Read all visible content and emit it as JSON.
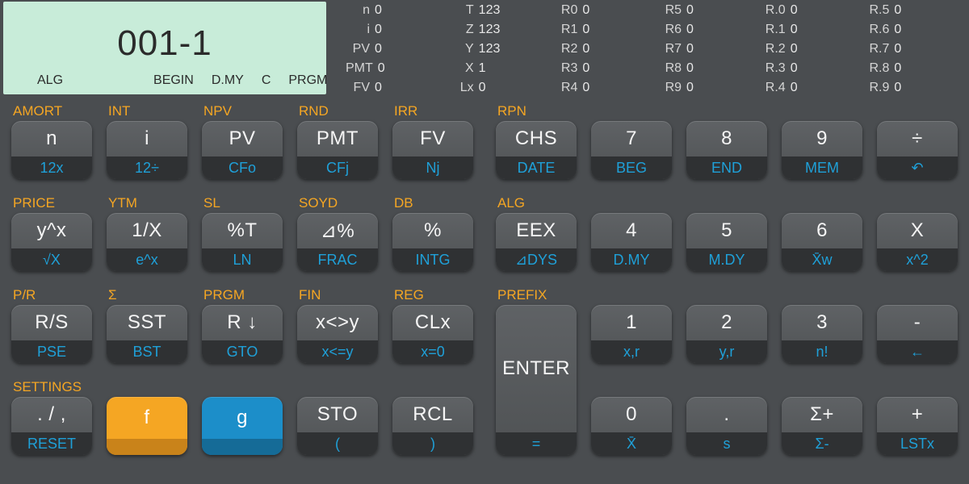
{
  "lcd": {
    "main": "001-1",
    "annunciators": [
      "ALG",
      "BEGIN",
      "D.MY",
      "C",
      "PRGM"
    ]
  },
  "registers": {
    "col1": [
      [
        "n",
        "0"
      ],
      [
        "i",
        "0"
      ],
      [
        "PV",
        "0"
      ],
      [
        "PMT",
        "0"
      ],
      [
        "FV",
        "0"
      ]
    ],
    "col2": [
      [
        "T",
        "123"
      ],
      [
        "Z",
        "123"
      ],
      [
        "Y",
        "123"
      ],
      [
        "X",
        "1"
      ],
      [
        "Lx",
        "0"
      ]
    ],
    "col3": [
      [
        "R0",
        "0"
      ],
      [
        "R1",
        "0"
      ],
      [
        "R2",
        "0"
      ],
      [
        "R3",
        "0"
      ],
      [
        "R4",
        "0"
      ]
    ],
    "col4": [
      [
        "R5",
        "0"
      ],
      [
        "R6",
        "0"
      ],
      [
        "R7",
        "0"
      ],
      [
        "R8",
        "0"
      ],
      [
        "R9",
        "0"
      ]
    ],
    "col5": [
      [
        "R.0",
        "0"
      ],
      [
        "R.1",
        "0"
      ],
      [
        "R.2",
        "0"
      ],
      [
        "R.3",
        "0"
      ],
      [
        "R.4",
        "0"
      ]
    ],
    "col6": [
      [
        "R.5",
        "0"
      ],
      [
        "R.6",
        "0"
      ],
      [
        "R.7",
        "0"
      ],
      [
        "R.8",
        "0"
      ],
      [
        "R.9",
        "0"
      ]
    ]
  },
  "orange_labels": {
    "r1": [
      "AMORT",
      "INT",
      "NPV",
      "RND",
      "IRR",
      "RPN"
    ],
    "r2": [
      "PRICE",
      "YTM",
      "SL",
      "SOYD",
      "DB",
      "ALG"
    ],
    "r3": [
      "P/R",
      "Σ",
      "PRGM",
      "FIN",
      "REG",
      "PREFIX"
    ],
    "r4": [
      "SETTINGS"
    ]
  },
  "keys": {
    "r1": [
      {
        "face": "n",
        "sub": "12x"
      },
      {
        "face": "i",
        "sub": "12÷"
      },
      {
        "face": "PV",
        "sub": "CFo"
      },
      {
        "face": "PMT",
        "sub": "CFj"
      },
      {
        "face": "FV",
        "sub": "Nj"
      },
      {
        "face": "CHS",
        "sub": "DATE"
      },
      {
        "face": "7",
        "sub": "BEG"
      },
      {
        "face": "8",
        "sub": "END"
      },
      {
        "face": "9",
        "sub": "MEM"
      },
      {
        "face": "÷",
        "sub": "↶"
      }
    ],
    "r2": [
      {
        "face": "y^x",
        "sub": "√X"
      },
      {
        "face": "1/X",
        "sub": "e^x"
      },
      {
        "face": "%T",
        "sub": "LN"
      },
      {
        "face": "⊿%",
        "sub": "FRAC"
      },
      {
        "face": "%",
        "sub": "INTG"
      },
      {
        "face": "EEX",
        "sub": "⊿DYS"
      },
      {
        "face": "4",
        "sub": "D.MY"
      },
      {
        "face": "5",
        "sub": "M.DY"
      },
      {
        "face": "6",
        "sub": "X̄w"
      },
      {
        "face": "X",
        "sub": "x^2"
      }
    ],
    "r3": [
      {
        "face": "R/S",
        "sub": "PSE"
      },
      {
        "face": "SST",
        "sub": "BST"
      },
      {
        "face": "R ↓",
        "sub": "GTO"
      },
      {
        "face": "x<>y",
        "sub": "x<=y"
      },
      {
        "face": "CLx",
        "sub": "x=0"
      }
    ],
    "r3_right": [
      {
        "face": "1",
        "sub": "x,r"
      },
      {
        "face": "2",
        "sub": "y,r"
      },
      {
        "face": "3",
        "sub": "n!"
      },
      {
        "face": "-",
        "sub": "←"
      }
    ],
    "enter": {
      "face": "ENTER",
      "sub": "="
    },
    "r4": [
      {
        "face": ". / ,",
        "sub": "RESET"
      },
      {
        "face": "f",
        "sub": "",
        "style": "f"
      },
      {
        "face": "g",
        "sub": "",
        "style": "g"
      },
      {
        "face": "STO",
        "sub": "("
      },
      {
        "face": "RCL",
        "sub": ")"
      }
    ],
    "r4_right": [
      {
        "face": "0",
        "sub": "X̄"
      },
      {
        "face": ".",
        "sub": "s"
      },
      {
        "face": "Σ+",
        "sub": "Σ-"
      },
      {
        "face": "+",
        "sub": "LSTx"
      }
    ]
  }
}
